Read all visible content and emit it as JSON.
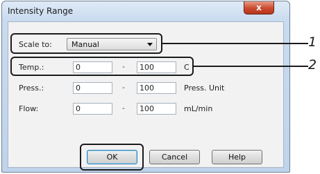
{
  "window": {
    "title": "Intensity Range",
    "close_symbol": "x"
  },
  "scale": {
    "label": "Scale to:",
    "value": "Manual"
  },
  "rows": [
    {
      "label": "Temp.:",
      "min": "0",
      "separator": "-",
      "max": "100",
      "unit": "C"
    },
    {
      "label": "Press.:",
      "min": "0",
      "separator": "-",
      "max": "100",
      "unit": "Press. Unit"
    },
    {
      "label": "Flow:",
      "min": "0",
      "separator": "-",
      "max": "100",
      "unit": "mL/min"
    }
  ],
  "buttons": {
    "ok": "OK",
    "cancel": "Cancel",
    "help": "Help"
  },
  "callouts": {
    "one": "1",
    "two": "2"
  }
}
